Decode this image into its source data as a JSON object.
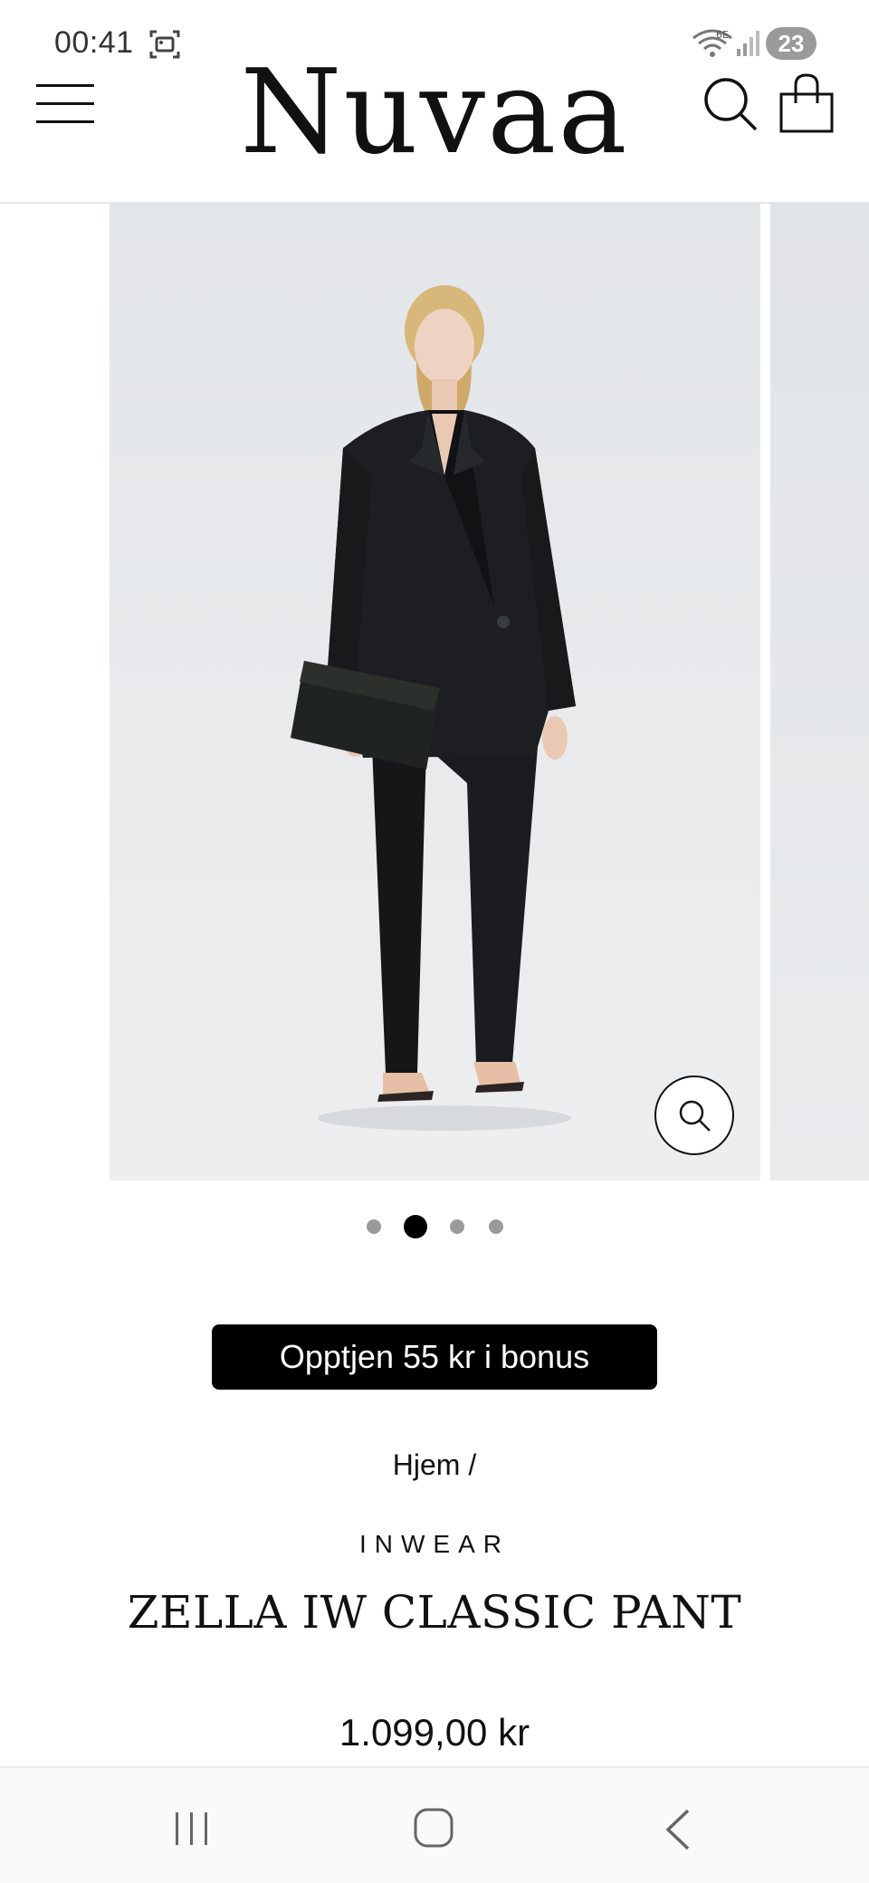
{
  "status_bar": {
    "time": "00:41",
    "battery_level": "23",
    "icons": [
      "screenshot-icon",
      "wifi-6e-icon",
      "signal-icon",
      "battery-icon"
    ]
  },
  "header": {
    "logo": "Nuvaa",
    "icons": [
      "menu-icon",
      "search-icon",
      "shopping-bag-icon"
    ]
  },
  "gallery": {
    "slide_count": 4,
    "active_index": 1,
    "zoom_icon": "magnifier-icon"
  },
  "product": {
    "bonus_text": "Opptjen 55 kr i bonus",
    "breadcrumb": "Hjem /",
    "brand": "INWEAR",
    "title": "ZELLA IW CLASSIC PANT",
    "price": "1.099,00 kr"
  },
  "colors": {
    "accent": "#000000",
    "image_background": "#e6e9eb",
    "dot_inactive": "#9a9a9a",
    "dot_active": "#000000"
  },
  "nav_bar": {
    "icons": [
      "recents-icon",
      "home-icon",
      "back-icon"
    ]
  }
}
